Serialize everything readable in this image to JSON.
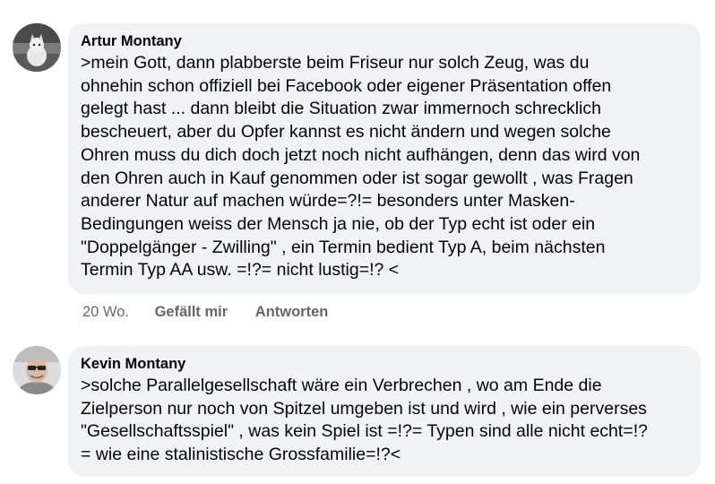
{
  "comments": [
    {
      "author": "Artur Montany",
      "avatar_icon": "profile-photo-cat",
      "text": ">mein Gott, dann plabberste beim Friseur nur solch Zeug, was du\nohnehin schon offiziell bei Facebook oder eigener Präsentation offen\ngelegt hast ... dann bleibt die Situation zwar immernoch schrecklich\nbescheuert, aber du Opfer kannst es nicht ändern und wegen solche\nOhren muss du dich doch  jetzt noch nicht aufhängen, denn das wird von\nden Ohren  auch in Kauf genommen oder ist sogar gewollt , was Fragen\nanderer Natur auf machen würde=?!= besonders unter Masken-\nBedingungen weiss der Mensch ja nie, ob der Typ echt ist oder ein\n\"Doppelgänger - Zwilling\" , ein Termin bedient Typ A, beim nächsten\nTermin Typ AA usw. =!?= nicht lustig=!? <",
      "age": "20 Wo.",
      "like_label": "Gefällt mir",
      "reply_label": "Antworten"
    },
    {
      "author": "Kevin Montany",
      "avatar_icon": "profile-photo-man",
      "text": ">solche Parallelgesellschaft wäre ein Verbrechen , wo am Ende die\nZielperson nur noch von Spitzel umgeben ist und wird , wie ein perverses\n\"Gesellschaftsspiel\" , was kein Spiel ist =!?= Typen sind alle nicht echt=!?\n= wie eine stalinistische Grossfamilie=!?<"
    }
  ]
}
